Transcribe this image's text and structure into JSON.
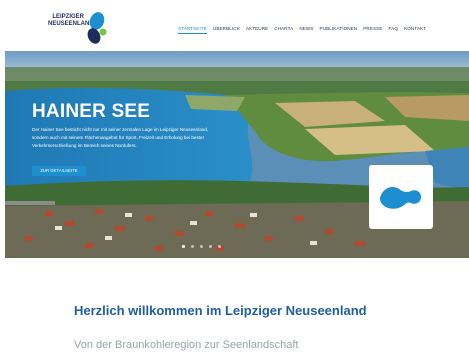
{
  "header": {
    "logo_line1": "LEIPZIGER",
    "logo_line2": "NEUSEENLAND",
    "nav": [
      {
        "label": "STARTSEITE",
        "active": true
      },
      {
        "label": "ÜBERBLICK",
        "active": false
      },
      {
        "label": "AKTEURE",
        "active": false
      },
      {
        "label": "CHARTA",
        "active": false
      },
      {
        "label": "NEWS",
        "active": false
      },
      {
        "label": "PUBLIKATIONEN",
        "active": false
      },
      {
        "label": "PRESSE",
        "active": false
      },
      {
        "label": "FAQ",
        "active": false
      },
      {
        "label": "KONTAKT",
        "active": false
      }
    ]
  },
  "hero": {
    "title": "HAINER SEE",
    "text": "Der Hainer See besticht nicht nur mit seiner zentralen Lage im Leipziger Neuseenland, sondern auch mit seinem Flächenangebot für Sport, Freizeit und Erholung bei bester Verkehrserschließung im Bereich seines Nordufers.",
    "button_label": "ZUR DETAILSEITE",
    "slides": 5,
    "active_slide": 0
  },
  "welcome": {
    "title": "Herzlich willkommen im Leipziger Neuseenland",
    "subtitle": "Von der Braunkohleregion zur Seenlandschaft"
  },
  "colors": {
    "brand_dark": "#1f2d5a",
    "accent": "#1d8fd0",
    "title_blue": "#1f5fa0",
    "subtitle_gray": "#9aa3ab"
  }
}
